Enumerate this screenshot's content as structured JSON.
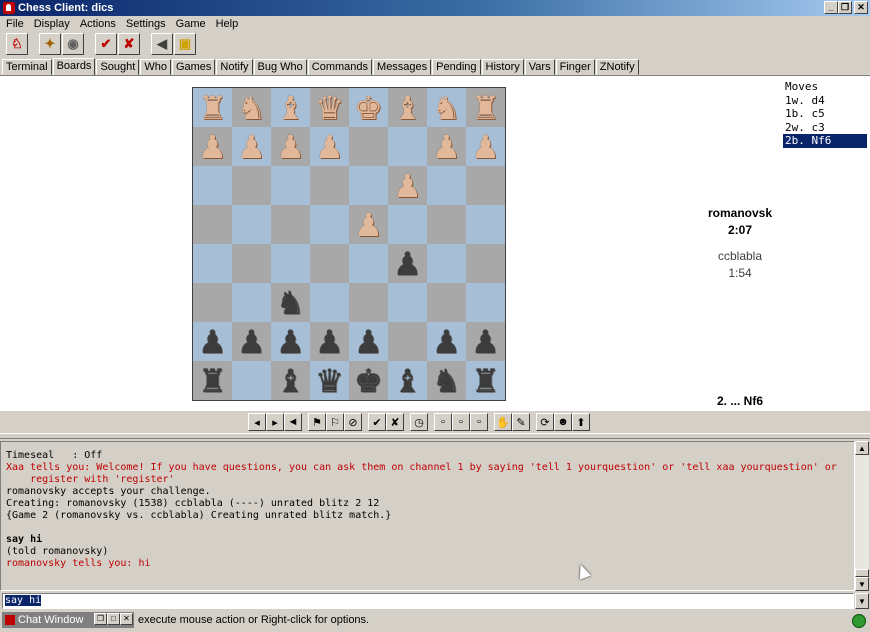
{
  "window": {
    "title": "Chess Client: dics",
    "controls": [
      "minimize",
      "maximize",
      "close"
    ]
  },
  "menu": [
    "File",
    "Display",
    "Actions",
    "Settings",
    "Game",
    "Help"
  ],
  "toolbar": {
    "groups": [
      [
        {
          "icon": "connect-icon",
          "glyph": "♘",
          "color": "#c00000"
        }
      ],
      [
        {
          "icon": "seek-icon",
          "glyph": "✦",
          "color": "#a06000"
        },
        {
          "icon": "observe-icon",
          "glyph": "◉",
          "color": "#606060"
        }
      ],
      [
        {
          "icon": "accept-icon",
          "glyph": "✔",
          "color": "#c00000"
        },
        {
          "icon": "decline-icon",
          "glyph": "✘",
          "color": "#c00000"
        }
      ],
      [
        {
          "icon": "sound-icon",
          "glyph": "◀",
          "color": "#404040"
        },
        {
          "icon": "flag-icon",
          "glyph": "▣",
          "color": "#d0a000"
        }
      ]
    ]
  },
  "tabs": [
    "Terminal",
    "Boards",
    "Sought",
    "Who",
    "Games",
    "Notify",
    "Bug Who",
    "Commands",
    "Messages",
    "Pending",
    "History",
    "Vars",
    "Finger",
    "ZNotify"
  ],
  "active_tab": "Boards",
  "board": {
    "rows": [
      [
        "♜",
        "♞",
        "♝",
        "♛",
        "♚",
        "♝",
        "♞",
        "♜"
      ],
      [
        "♟",
        "♟",
        "♟",
        "♟",
        "",
        "",
        "♟",
        "♟"
      ],
      [
        "",
        "",
        "",
        "",
        "",
        "♟",
        "",
        ""
      ],
      [
        "",
        "",
        "",
        "",
        "♟",
        "",
        "",
        ""
      ],
      [
        "",
        "",
        "",
        "",
        "",
        "♟",
        "",
        ""
      ],
      [
        "",
        "",
        "♞",
        "",
        "",
        "",
        "",
        ""
      ],
      [
        "♟",
        "♟",
        "♟",
        "♟",
        "♟",
        "",
        "♟",
        "♟"
      ],
      [
        "♜",
        "",
        "♝",
        "♛",
        "♚",
        "♝",
        "♞",
        "♜"
      ]
    ],
    "colors": [
      [
        "w",
        "w",
        "w",
        "w",
        "w",
        "w",
        "w",
        "w"
      ],
      [
        "w",
        "w",
        "w",
        "w",
        "",
        "",
        "w",
        "w"
      ],
      [
        "",
        "",
        "",
        "",
        "",
        "w",
        "",
        ""
      ],
      [
        "",
        "",
        "",
        "",
        "w",
        "",
        "",
        ""
      ],
      [
        "",
        "",
        "",
        "",
        "",
        "b",
        "",
        ""
      ],
      [
        "",
        "",
        "b",
        "",
        "",
        "",
        "",
        ""
      ],
      [
        "b",
        "b",
        "b",
        "b",
        "b",
        "",
        "b",
        "b"
      ],
      [
        "b",
        "",
        "b",
        "b",
        "b",
        "b",
        "b",
        "b"
      ]
    ]
  },
  "moves": {
    "header": "Moves",
    "list": [
      "1w. d4",
      "1b. c5",
      "2w. c3",
      "2b. Nf6"
    ],
    "selected_index": 3
  },
  "players": {
    "top": {
      "name": "romanovsk",
      "clock": "2:07"
    },
    "bottom": {
      "name": "ccblabla",
      "clock": "1:54"
    }
  },
  "last_move": "2. ... Nf6",
  "board_tools": [
    {
      "icon": "flip-board-icon",
      "glyph": "◂"
    },
    {
      "icon": "refresh-moves-icon",
      "glyph": "▸"
    },
    {
      "icon": "back-icon",
      "glyph": "◄"
    },
    {
      "icon": "draw-offer-icon",
      "glyph": "⚑"
    },
    {
      "icon": "abort-icon",
      "glyph": "⚐"
    },
    {
      "icon": "no-icon",
      "glyph": "⊘"
    },
    {
      "icon": "accept-icon",
      "glyph": "✔"
    },
    {
      "icon": "decline-icon",
      "glyph": "✘"
    },
    {
      "icon": "clock-icon",
      "glyph": "◷"
    },
    {
      "icon": "square-a-icon",
      "glyph": "▫"
    },
    {
      "icon": "square-b-icon",
      "glyph": "▫"
    },
    {
      "icon": "square-c-icon",
      "glyph": "▫"
    },
    {
      "icon": "hand-icon",
      "glyph": "✋"
    },
    {
      "icon": "edit-icon",
      "glyph": "✎"
    },
    {
      "icon": "rematch-icon",
      "glyph": "⟳"
    },
    {
      "icon": "user-icon",
      "glyph": "☻"
    },
    {
      "icon": "up-arrow-icon",
      "glyph": "⬆"
    }
  ],
  "console": [
    {
      "text": "Timeseal   : Off",
      "style": ""
    },
    {
      "text": "Xaa tells you: Welcome! If you have questions, you can ask them on channel 1 by saying 'tell 1 yourquestion' or 'tell xaa yourquestion' or",
      "style": "red"
    },
    {
      "text": "    register with 'register'",
      "style": "red"
    },
    {
      "text": "romanovsky accepts your challenge.",
      "style": ""
    },
    {
      "text": "Creating: romanovsky (1538) ccblabla (----) unrated blitz 2 12",
      "style": ""
    },
    {
      "text": "{Game 2 (romanovsky vs. ccblabla) Creating unrated blitz match.}",
      "style": ""
    },
    {
      "text": "",
      "style": ""
    },
    {
      "text": "say hi",
      "style": "bold"
    },
    {
      "text": "(told romanovsky)",
      "style": ""
    },
    {
      "text": "romanovsky tells you: hi",
      "style": "red"
    }
  ],
  "input": {
    "value": "say hi"
  },
  "status": {
    "chat_window_label": "Chat Window",
    "text": "execute mouse action or Right-click for options."
  }
}
